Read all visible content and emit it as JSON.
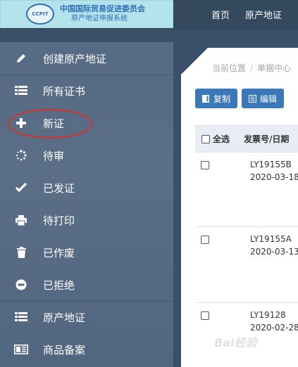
{
  "header": {
    "org_line1": "中国国际贸易促进委员会",
    "org_line2": "原产地证申报系统",
    "logo_text": "CCPIT",
    "nav": [
      "首页",
      "原产地证"
    ]
  },
  "sidebar": {
    "items": [
      {
        "label": "创建原产地证",
        "icon": "pencil-icon"
      },
      {
        "label": "所有证书",
        "icon": "list-icon"
      },
      {
        "label": "新证",
        "icon": "plus-icon"
      },
      {
        "label": "待审",
        "icon": "spinner-icon"
      },
      {
        "label": "已发证",
        "icon": "check-icon"
      },
      {
        "label": "待打印",
        "icon": "printer-icon"
      },
      {
        "label": "已作废",
        "icon": "trash-icon"
      },
      {
        "label": "已拒绝",
        "icon": "minus-circle-icon"
      },
      {
        "label": "原产地证",
        "icon": "list-icon"
      },
      {
        "label": "商品备案",
        "icon": "id-card-icon"
      }
    ]
  },
  "main": {
    "breadcrumb": [
      "当前位置",
      "单据中心"
    ],
    "toolbar": {
      "copy_label": "复制",
      "edit_label": "编辑"
    },
    "table": {
      "headers": [
        "全选",
        "发票号/日期"
      ],
      "rows": [
        {
          "invoice": "LY19155B",
          "date": "2020-03-18"
        },
        {
          "invoice": "LY19155A",
          "date": "2020-03-13"
        },
        {
          "invoice": "LY19128",
          "date": "2020-02-28"
        }
      ]
    }
  },
  "watermark": "Bai经验",
  "colors": {
    "accent": "#3a78b8",
    "sidebar": "#566b84",
    "highlight": "#d8302b",
    "logo_bg": "#b5e3ec"
  }
}
